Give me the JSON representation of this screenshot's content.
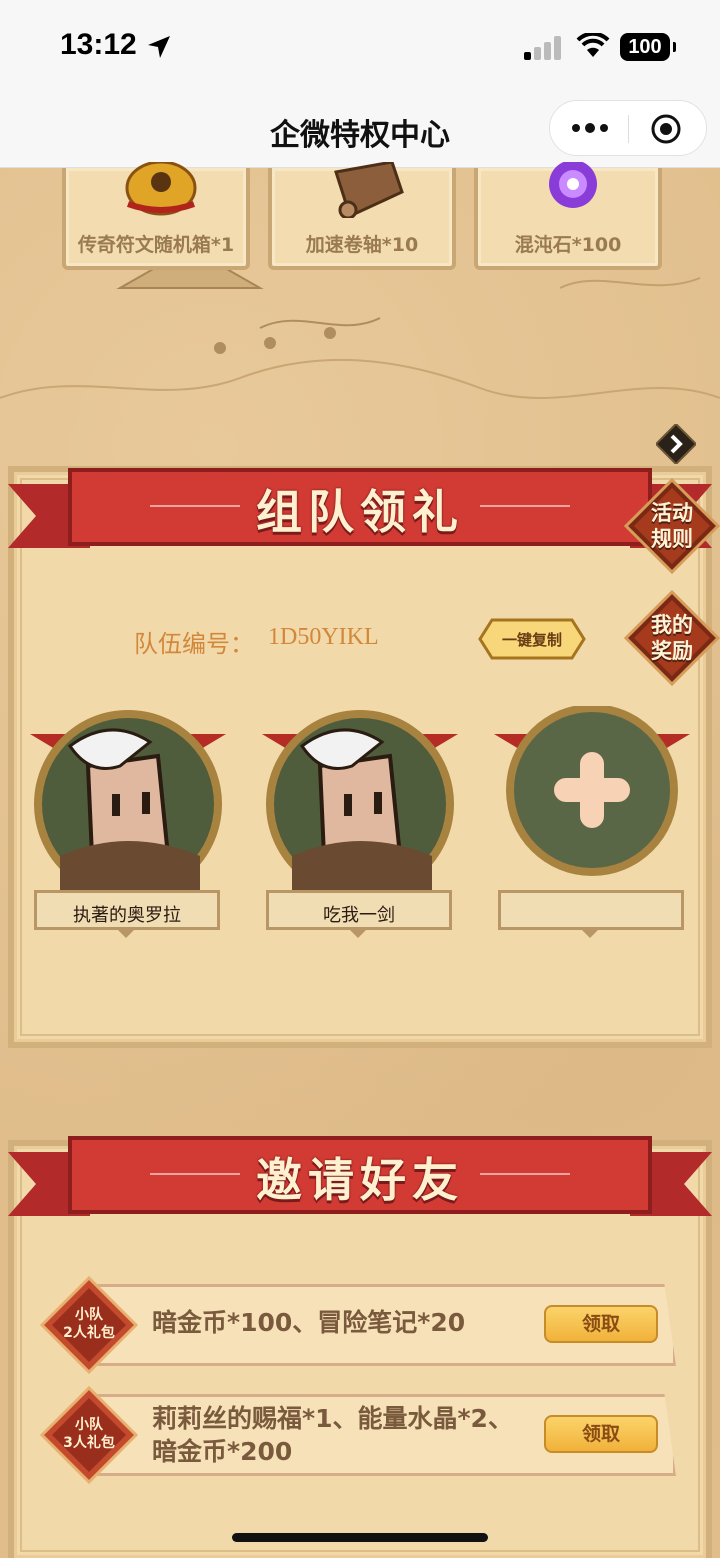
{
  "status_bar": {
    "time": "13:12",
    "battery": "100"
  },
  "nav": {
    "title": "企微特权中心"
  },
  "rewards_top": [
    {
      "label": "传奇符文随机箱*1",
      "icon": "rune-bag-icon"
    },
    {
      "label": "加速卷轴*10",
      "icon": "scroll-icon"
    },
    {
      "label": "混沌石*100",
      "icon": "chaos-stone-icon"
    }
  ],
  "team_section": {
    "title": "组队领礼",
    "rules_label": "活动规则",
    "my_rewards_label": "我的奖励",
    "team_id_label": "队伍编号：",
    "team_id": "1D50YIKL",
    "copy_label": "一键复制",
    "members": [
      {
        "name": "执著的奥罗拉"
      },
      {
        "name": "吃我一剑"
      },
      {
        "name": ""
      }
    ]
  },
  "invite_section": {
    "title": "邀请好友",
    "rows": [
      {
        "badge_line1": "小队",
        "badge_line2": "2人礼包",
        "text_line1": "暗金币*100、冒险笔记*20",
        "text_line2": "",
        "button": "领取"
      },
      {
        "badge_line1": "小队",
        "badge_line2": "3人礼包",
        "text_line1": "莉莉丝的赐福*1、能量水晶*2、",
        "text_line2": "暗金币*200",
        "button": "领取"
      }
    ]
  },
  "colors": {
    "ribbon": "#c72f2f",
    "accent_text": "#d2883a",
    "button": "#f4bf4c"
  }
}
